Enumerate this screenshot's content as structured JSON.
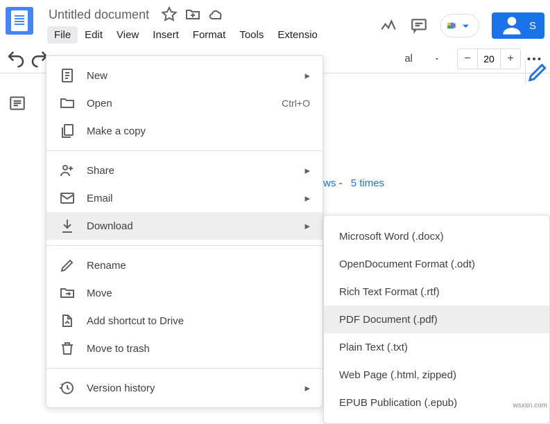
{
  "header": {
    "title": "Untitled document",
    "menus": [
      "File",
      "Edit",
      "View",
      "Insert",
      "Format",
      "Tools",
      "Extensio"
    ]
  },
  "share": {
    "label": "S"
  },
  "toolbar": {
    "font": "al",
    "zoom": "20"
  },
  "body": {
    "views": "ws",
    "dash": "-",
    "times": "5 times"
  },
  "fileMenu": {
    "new": "New",
    "open": "Open",
    "open_shortcut": "Ctrl+O",
    "copy": "Make a copy",
    "share": "Share",
    "email": "Email",
    "download": "Download",
    "rename": "Rename",
    "move": "Move",
    "shortcut": "Add shortcut to Drive",
    "trash": "Move to trash",
    "history": "Version history"
  },
  "downloadMenu": {
    "docx": "Microsoft Word (.docx)",
    "odt": "OpenDocument Format (.odt)",
    "rtf": "Rich Text Format (.rtf)",
    "pdf": "PDF Document (.pdf)",
    "txt": "Plain Text (.txt)",
    "html": "Web Page (.html, zipped)",
    "epub": "EPUB Publication (.epub)"
  },
  "watermark": "wsxsn.com"
}
